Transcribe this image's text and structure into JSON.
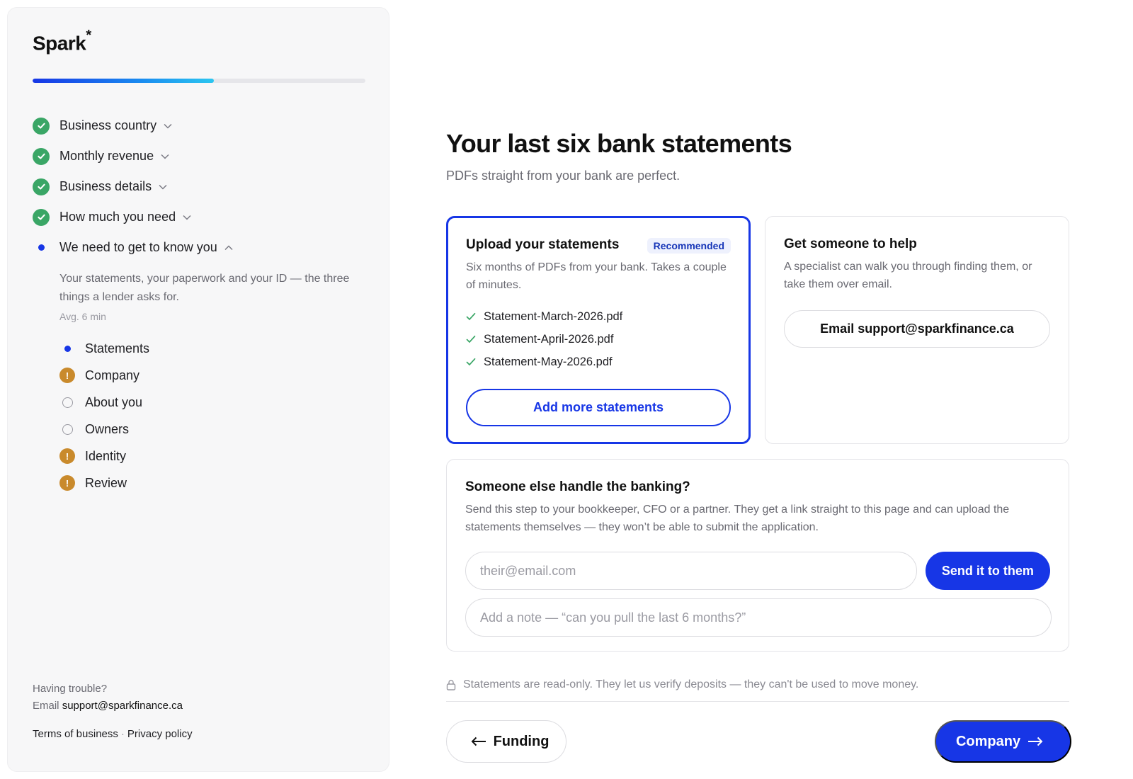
{
  "brand": {
    "name": "Spark",
    "mark": "*"
  },
  "progress": {
    "fraction": 0.545
  },
  "steps": [
    {
      "label": "Business country",
      "status": "done"
    },
    {
      "label": "Monthly revenue",
      "status": "done"
    },
    {
      "label": "Business details",
      "status": "done"
    },
    {
      "label": "How much you need",
      "status": "done"
    },
    {
      "label": "We need to get to know you",
      "status": "current"
    }
  ],
  "current_step": {
    "description": "Your statements, your paperwork and your ID — the three things a lender asks for.",
    "avg": "Avg. 6 min",
    "substeps": [
      {
        "label": "Statements",
        "status": "current"
      },
      {
        "label": "Company",
        "status": "warning"
      },
      {
        "label": "About you",
        "status": "todo"
      },
      {
        "label": "Owners",
        "status": "todo"
      },
      {
        "label": "Identity",
        "status": "warning"
      },
      {
        "label": "Review",
        "status": "warning"
      }
    ]
  },
  "help": {
    "question": "Having trouble?",
    "email_prefix": "Email",
    "email": "support@sparkfinance.ca",
    "terms": "Terms of business",
    "separator": "·",
    "privacy": "Privacy policy"
  },
  "main": {
    "title": "Your last six bank statements",
    "subtitle": "PDFs straight from your bank are perfect.",
    "upload_card": {
      "title": "Upload your statements",
      "badge": "Recommended",
      "description": "Six months of PDFs from your bank. Takes a couple of minutes.",
      "files": [
        "Statement-March-2026.pdf",
        "Statement-April-2026.pdf",
        "Statement-May-2026.pdf"
      ],
      "add_button": "Add more statements"
    },
    "help_card": {
      "title": "Get someone to help",
      "description": "A specialist can walk you through finding them, or take them over email.",
      "email_button": "Email support@sparkfinance.ca"
    },
    "handoff_card": {
      "title": "Someone else handle the banking?",
      "description": "Send this step to your bookkeeper, CFO or a partner. They get a link straight to this page and can upload the statements themselves — they won’t be able to submit the application.",
      "email_placeholder": "their@email.com",
      "send_button": "Send it to them",
      "note_placeholder": "Add a note — “can you pull the last 6 months?”"
    },
    "security_note": "Statements are read-only. They let us verify deposits — they can't be used to move money.",
    "nav": {
      "back": "Funding",
      "next": "Company"
    }
  },
  "colors": {
    "accent": "#1736e6",
    "success": "#3aa666",
    "warning": "#c98a2c"
  }
}
